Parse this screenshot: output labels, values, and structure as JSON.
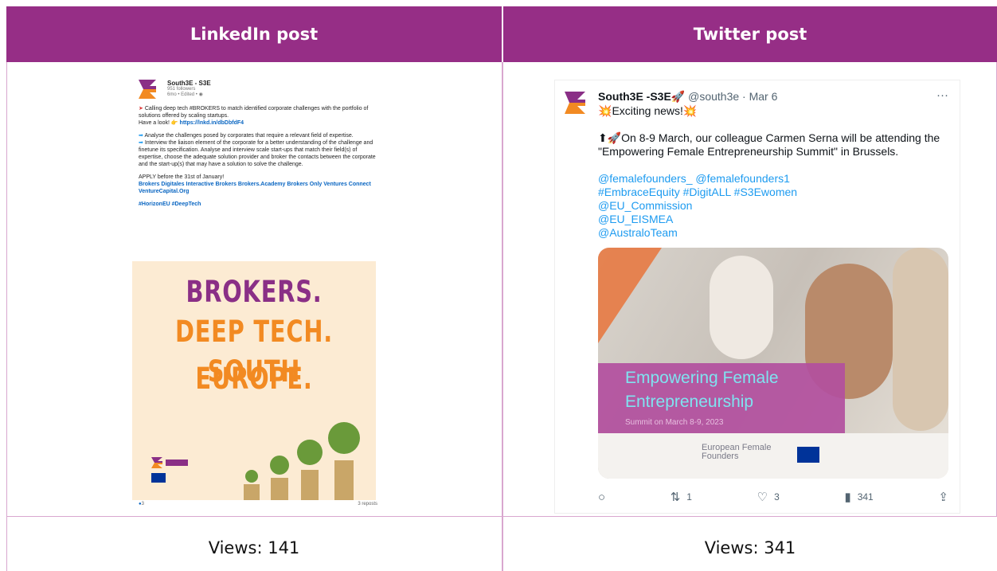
{
  "headers": {
    "left": "LinkedIn post",
    "right": "Twitter post"
  },
  "views": {
    "left": "Views: 141",
    "right": "Views: 341"
  },
  "linkedin": {
    "name": "South3E - S3E",
    "followers": "951 followers",
    "meta": "6mo • Edited •",
    "p1": "Calling deep tech #BROKERS to match identified corporate challenges with the portfolio of solutions offered by scaling startups.",
    "p1b": "Have a look!",
    "link": "https://lnkd.in/dbDbfdF4",
    "p2": "Analyse the challenges posed by corporates that require a relevant field of expertise.",
    "p3": "Interview the liaison element of the corporate for a better understanding of the challenge and finetune its specification. Analyse and interview scale start-ups that match their field(s) of expertise, choose the adequate solution provider and broker the contacts between the corporate and the start-up(s) that may have a solution to solve the challenge.",
    "p4": "APPLY before the 31st of January!",
    "mentions": "Brokers Digitales Interactive Brokers Brokers.Academy Brokers Only Ventures Connect VentureCapital.Org",
    "tags": "#HorizonEU #DeepTech",
    "img_line1": "BROKERS.",
    "img_line2": "DEEP TECH.",
    "img_line3": "SOUTH EUROPE.",
    "reactions": "3",
    "reposts": "3 reposts"
  },
  "twitter": {
    "name": "South3E -S3E",
    "handle": "@south3e · Mar 6",
    "more": "···",
    "line1": "Exciting news!",
    "line2": "On 8-9 March, our colleague Carmen Serna will be attending the \"Empowering Female Entrepreneurship Summit\" in Brussels.",
    "m1": "@femalefounders_ @femalefounders1",
    "m2": "#EmbraceEquity #DigitALL #S3Ewomen",
    "m3": "@EU_Commission",
    "m4": "@EU_EISMEA",
    "m5": "@AustraloTeam",
    "media_t1": "Empowering Female",
    "media_t2": "Entrepreneurship",
    "media_t3": "Summit on March 8-9, 2023",
    "media_logo": "European Female Founders",
    "retweets": "1",
    "likes": "3",
    "views": "341"
  }
}
